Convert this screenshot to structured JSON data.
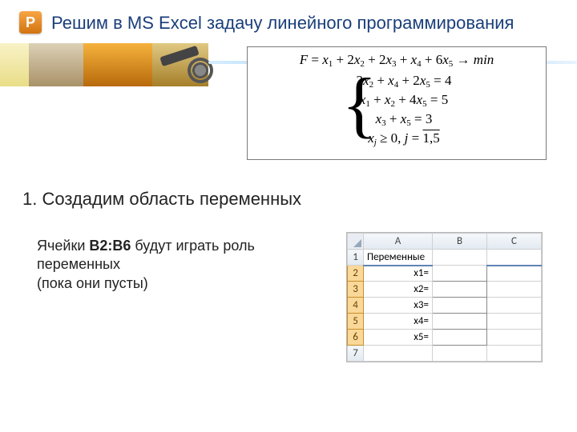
{
  "icon_letter": "P",
  "title": "Решим в MS Excel задачу линейного программирования",
  "formula": {
    "objective_html": "<i>F</i> = <i>x</i><span class='sub'>1</span> + 2<i>x</i><span class='sub'>2</span> + 2<i>x</i><span class='sub'>3</span> + <i>x</i><span class='sub'>4</span> + 6<i>x</i><span class='sub'>5</span> → <i>min</i>",
    "constraints_html": [
      "2<i>x</i><span class='sub'>2</span> + <i>x</i><span class='sub'>4</span> + 2<i>x</i><span class='sub'>5</span> = 4",
      "<i>x</i><span class='sub'>1</span> + <i>x</i><span class='sub'>2</span> + 4<i>x</i><span class='sub'>5</span> = 5",
      "<i>x</i><span class='sub'>3</span> + <i>x</i><span class='sub'>5</span> = 3",
      "<i>x</i><span class='sub'><i>j</i></span> ≥ 0, <i>j</i> = <span class='over'>1,5</span>"
    ]
  },
  "step_heading": "1. Создадим область переменных",
  "paragraph": {
    "prefix": "Ячейки ",
    "range": "B2:B6",
    "rest": " будут играть роль переменных",
    "note": "(пока они пусты)"
  },
  "excel": {
    "columns": [
      "A",
      "B",
      "C"
    ],
    "rows": [
      {
        "n": "1",
        "a": "Переменные",
        "b": "",
        "c": ""
      },
      {
        "n": "2",
        "a": "x1=",
        "b": "",
        "c": ""
      },
      {
        "n": "3",
        "a": "x2=",
        "b": "",
        "c": ""
      },
      {
        "n": "4",
        "a": "x3=",
        "b": "",
        "c": ""
      },
      {
        "n": "5",
        "a": "x4=",
        "b": "",
        "c": ""
      },
      {
        "n": "6",
        "a": "x5=",
        "b": "",
        "c": ""
      },
      {
        "n": "7",
        "a": "",
        "b": "",
        "c": ""
      }
    ],
    "selected_rows": [
      "2",
      "3",
      "4",
      "5",
      "6"
    ]
  }
}
